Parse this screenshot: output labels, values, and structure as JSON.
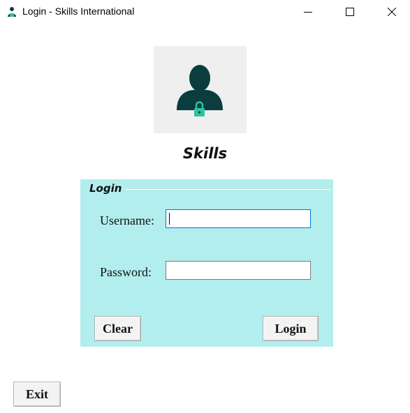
{
  "window": {
    "title": "Login - Skills International",
    "icons": [
      "app-user-icon",
      "minimize-icon",
      "maximize-icon",
      "close-icon"
    ]
  },
  "header": {
    "avatar_icon": "user-lock-icon",
    "brand": "Skills"
  },
  "login_group": {
    "legend": "Login",
    "username_label": "Username:",
    "username_value": "",
    "password_label": "Password:",
    "password_value": "",
    "clear_label": "Clear",
    "login_label": "Login"
  },
  "footer": {
    "exit_label": "Exit"
  },
  "colors": {
    "panel": "#b2eeee",
    "avatar_bg": "#efefef",
    "avatar_figure": "#0b3d3f",
    "lock": "#2ec4a0",
    "focus_border": "#0078d7"
  }
}
